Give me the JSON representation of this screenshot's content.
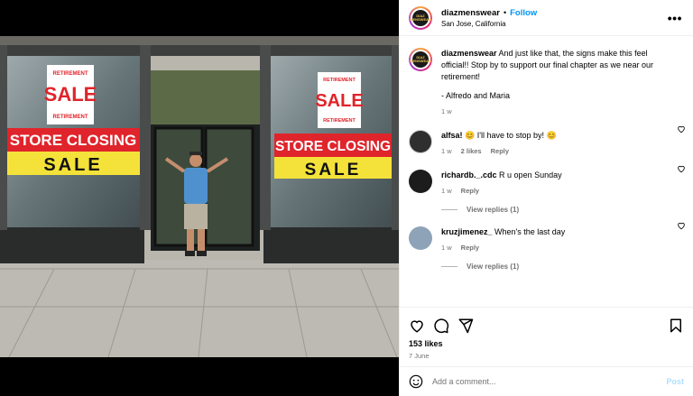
{
  "post": {
    "username": "diazmenswear",
    "follow_label": "Follow",
    "separator": "•",
    "location": "San Jose, California",
    "more_label": "•••",
    "avatar_text": "DIAZ MENSWEAR",
    "photo_signs": {
      "retirement_top": "RETIREMENT",
      "sale": "SALE",
      "retirement_bottom": "RETIREMENT",
      "store_closing": "STORE CLOSING",
      "sale_banner": "SALE"
    }
  },
  "caption": {
    "username": "diazmenswear",
    "text": "And just like that, the signs make this feel official!! Stop by to support our final chapter as we near our retirement!",
    "signoff": "- Alfredo and Maria",
    "age": "1 w"
  },
  "comments": [
    {
      "username": "alfsa!",
      "text": "😊 I'll have to stop by! 😊",
      "age": "1 w",
      "likes": "2 likes",
      "reply_label": "Reply",
      "view_replies": ""
    },
    {
      "username": "richardb._.cdc",
      "text": "R u open Sunday",
      "age": "1 w",
      "likes": "",
      "reply_label": "Reply",
      "view_replies": "View replies (1)"
    },
    {
      "username": "kruzjimenez_",
      "text": "When's the last day",
      "age": "1 w",
      "likes": "",
      "reply_label": "Reply",
      "view_replies": "View replies (1)"
    }
  ],
  "actions": {
    "like_icon": "heart-icon",
    "comment_icon": "comment-icon",
    "share_icon": "share-icon",
    "save_icon": "bookmark-icon",
    "likes": "153 likes",
    "date": "7 June"
  },
  "add_comment": {
    "placeholder": "Add a comment...",
    "post_label": "Post"
  },
  "colors": {
    "link_blue": "#0095f6",
    "post_disabled": "#b2dffc",
    "meta_gray": "#737373",
    "sign_red": "#e0242b",
    "sign_yellow": "#f4e23a"
  }
}
